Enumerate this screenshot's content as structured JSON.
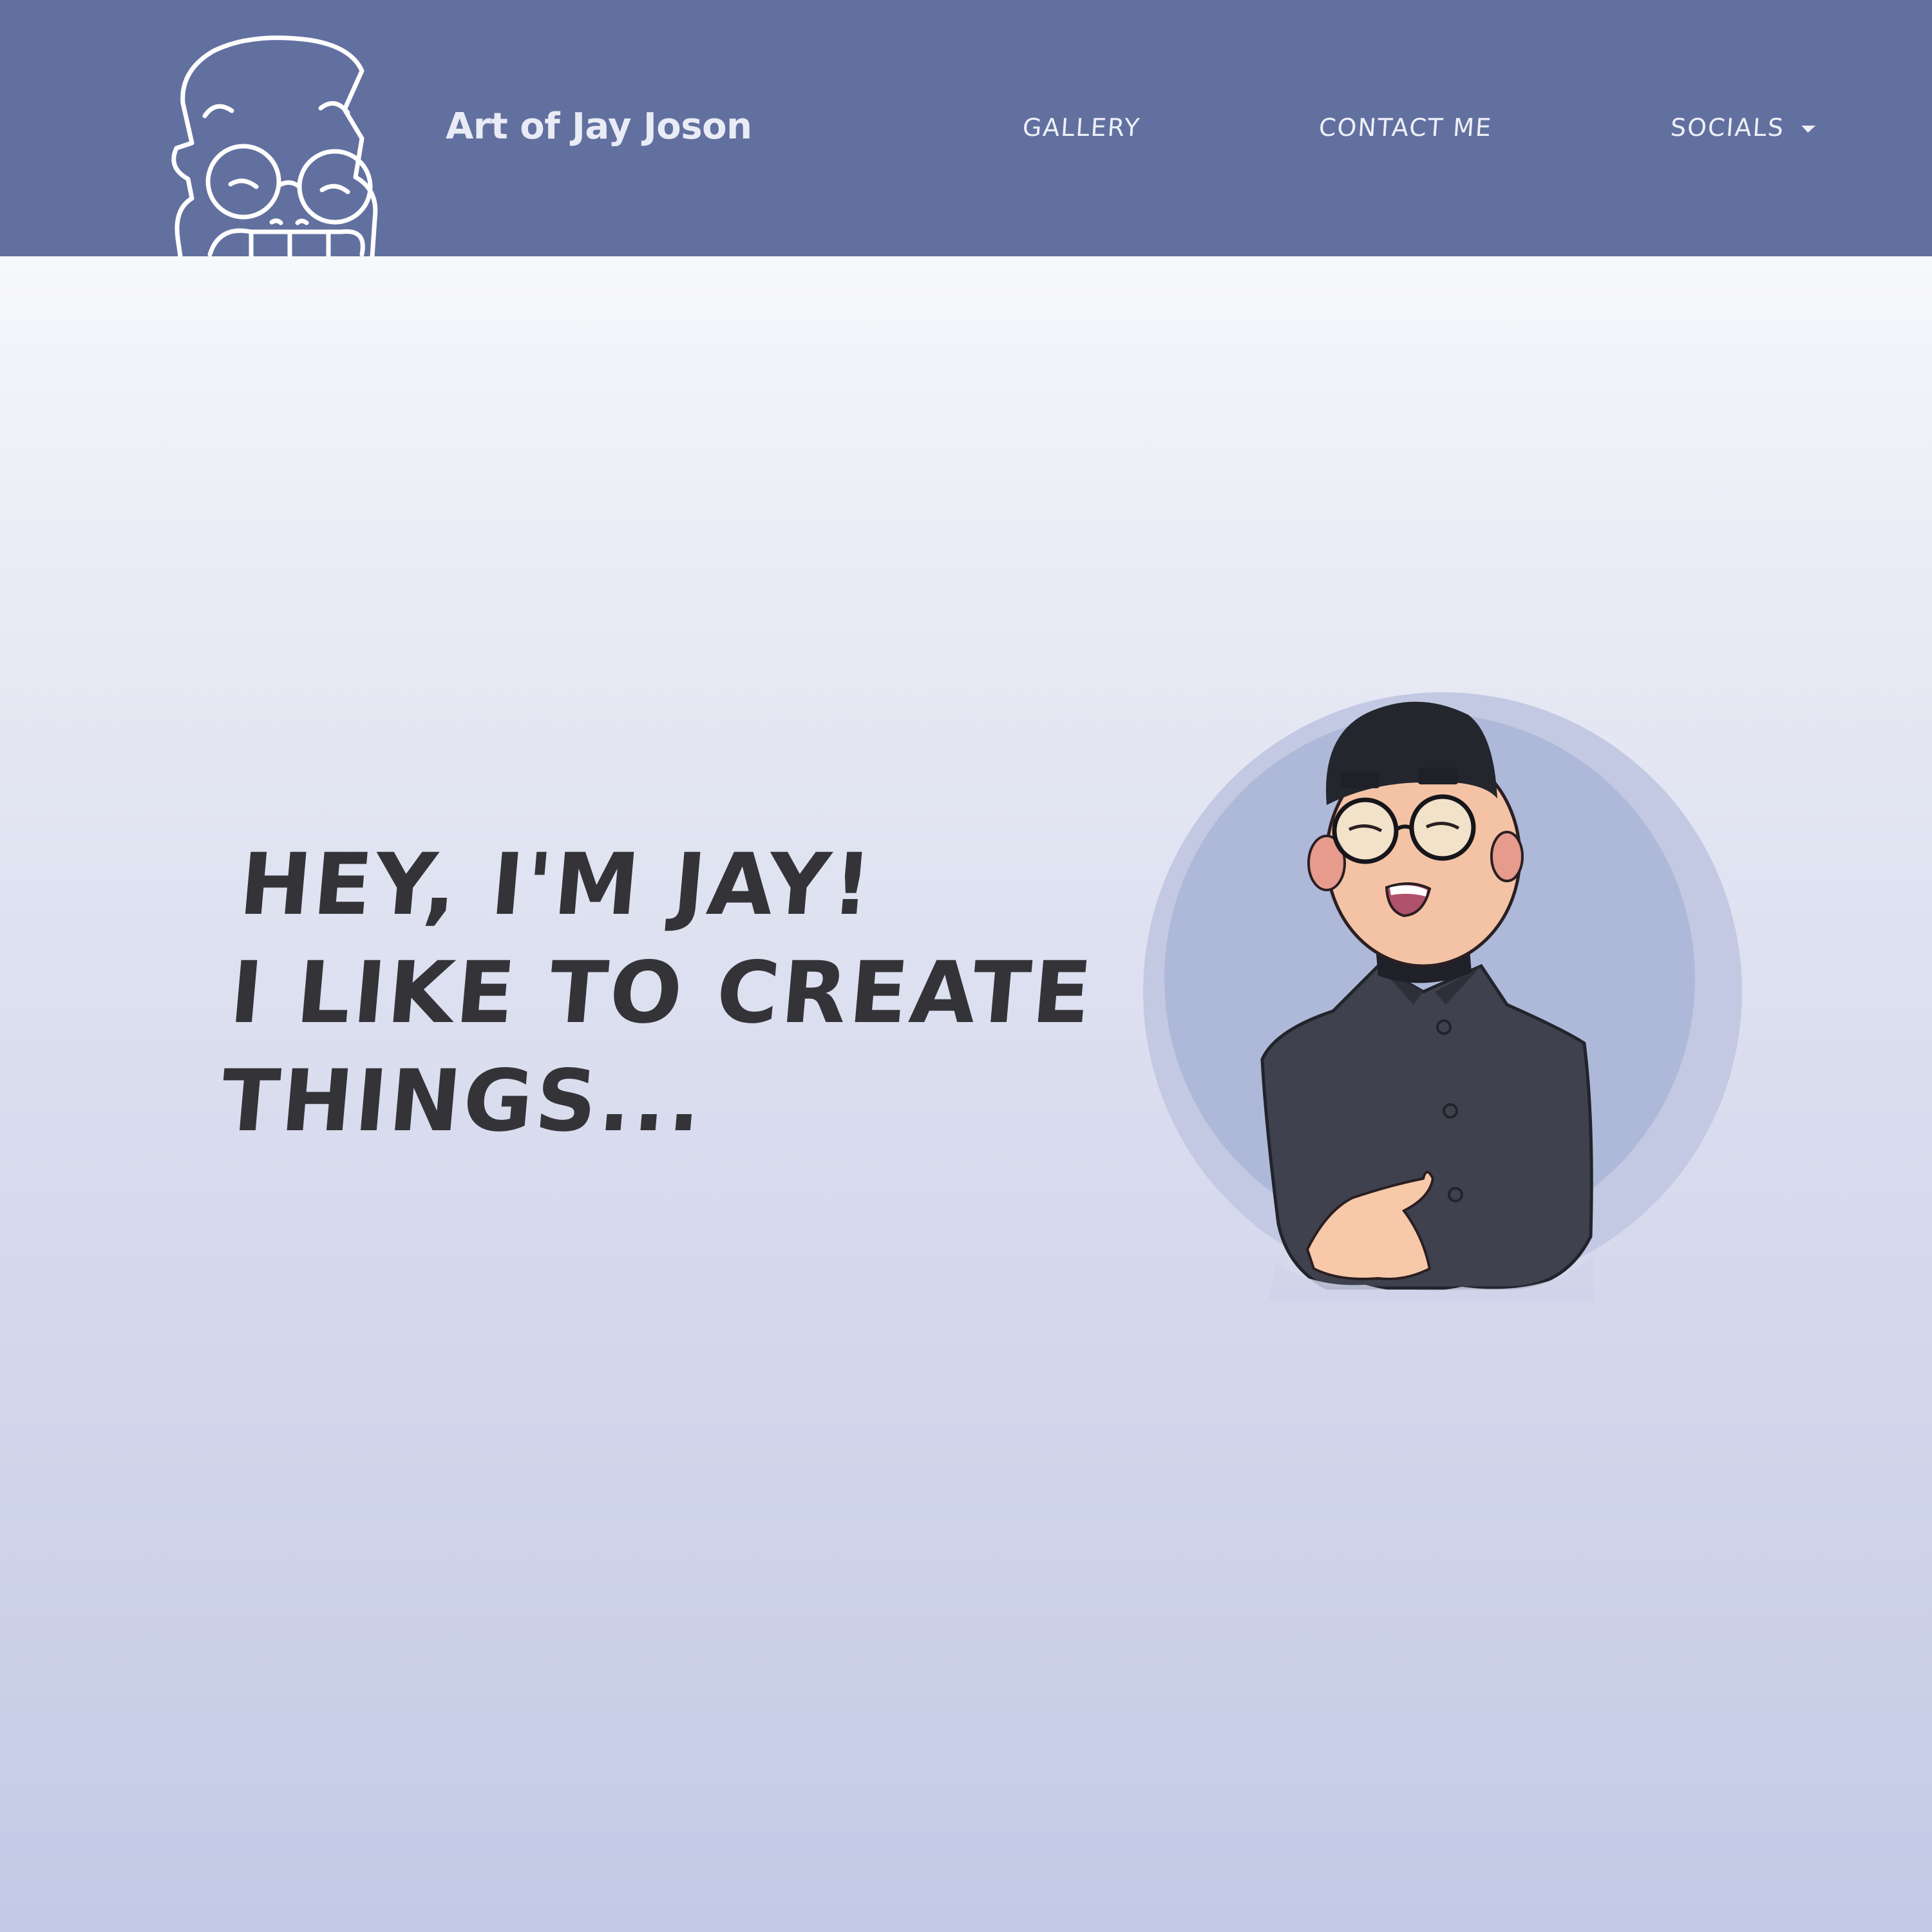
{
  "header": {
    "title": "Art of Jay Joson",
    "nav": {
      "gallery": "GALLERY",
      "contact": "CONTACT ME",
      "socials": "SOCIALS"
    }
  },
  "hero": {
    "line1": "HEY, I'M JAY!",
    "line2": "I LIKE TO CREATE",
    "line3": "THINGS..."
  },
  "colors": {
    "header_bg": "#6270a0",
    "text_dark": "#343438",
    "circle_outer": "#c3c9e2",
    "circle_inner": "#aeb8d8"
  },
  "icons": {
    "logo": "cartoon-face-logo-icon",
    "socials_caret": "caret-down-icon"
  }
}
